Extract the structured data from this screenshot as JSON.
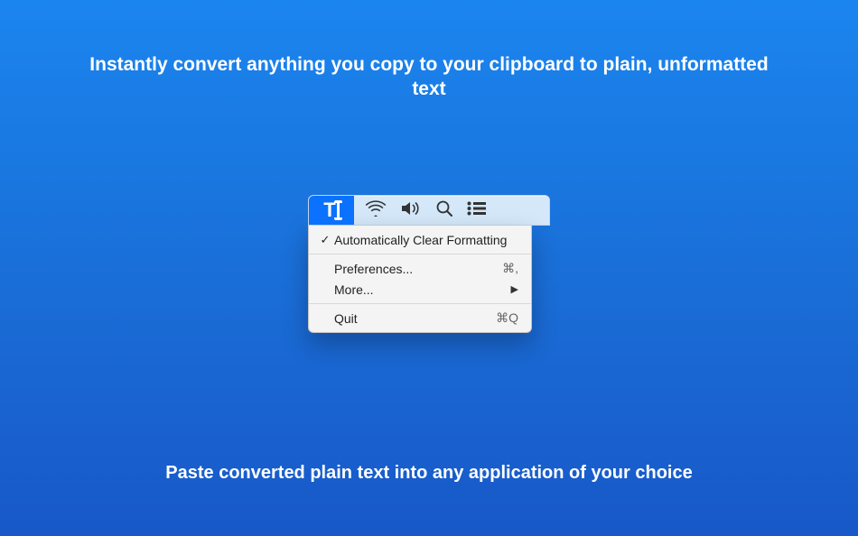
{
  "headline": "Instantly convert anything you copy to your clipboard to plain, unformatted text",
  "footline": "Paste converted plain text into any application of your choice",
  "menubar": {
    "app_icon": "text-cursor-icon"
  },
  "menu": {
    "auto_clear": {
      "label": "Automatically Clear Formatting",
      "checked": "✓"
    },
    "preferences": {
      "label": "Preferences...",
      "accel": "⌘,"
    },
    "more": {
      "label": "More...",
      "arrow": "▶"
    },
    "quit": {
      "label": "Quit",
      "accel": "⌘Q"
    }
  }
}
